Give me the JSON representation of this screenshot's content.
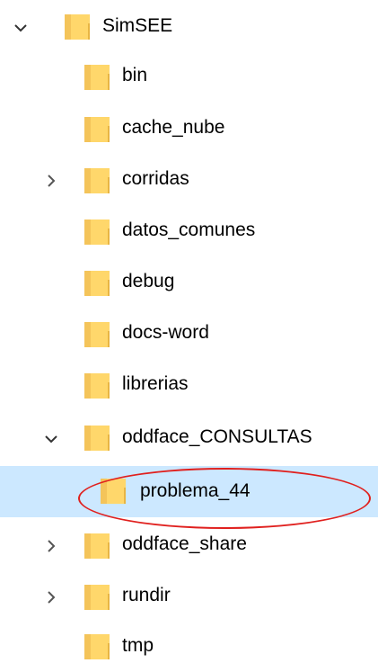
{
  "tree": {
    "root": {
      "label": "SimSEE",
      "state": "expanded"
    },
    "items": [
      {
        "label": "bin",
        "state": "none"
      },
      {
        "label": "cache_nube",
        "state": "none"
      },
      {
        "label": "corridas",
        "state": "collapsed"
      },
      {
        "label": "datos_comunes",
        "state": "none"
      },
      {
        "label": "debug",
        "state": "none"
      },
      {
        "label": "docs-word",
        "state": "none"
      },
      {
        "label": "librerias",
        "state": "none"
      },
      {
        "label": "oddface_CONSULTAS",
        "state": "expanded"
      },
      {
        "label": "problema_44",
        "state": "none",
        "selected": true
      },
      {
        "label": "oddface_share",
        "state": "collapsed"
      },
      {
        "label": "rundir",
        "state": "collapsed"
      },
      {
        "label": "tmp",
        "state": "none"
      }
    ]
  },
  "annotation": {
    "color": "#e0201e"
  },
  "colors": {
    "selection": "#cce8ff",
    "folder": "#ffd76b",
    "folder_shade": "#e8b543"
  }
}
